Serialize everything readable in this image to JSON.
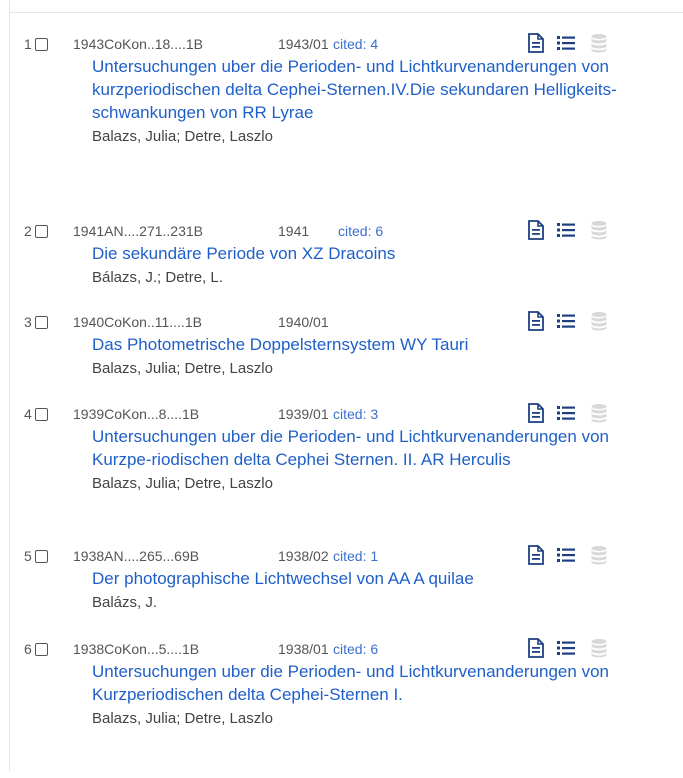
{
  "results": [
    {
      "index": "1",
      "bibcode": "1943CoKon..18....1B",
      "date": "1943/01",
      "cited": "cited: 4",
      "title": "Untersuchungen uber die Perioden- und Lichtkurvenanderungen von kurzperiodischen delta Cephei-Sternen.IV.Die sekundaren Helligkeits- schwankungen von RR Lyrae",
      "authors": "Balazs, Julia;  Detre, Laszlo"
    },
    {
      "index": "2",
      "bibcode": "1941AN....271..231B",
      "date": "1941",
      "cited": "cited: 6",
      "title": "Die sekundäre Periode von XZ Dracoins",
      "authors": "Bálazs, J.;  Detre, L."
    },
    {
      "index": "3",
      "bibcode": "1940CoKon..11....1B",
      "date": "1940/01",
      "cited": "",
      "title": "Das Photometrische Doppelsternsystem WY Tauri",
      "authors": "Balazs, Julia;  Detre, Laszlo"
    },
    {
      "index": "4",
      "bibcode": "1939CoKon...8....1B",
      "date": "1939/01",
      "cited": "cited: 3",
      "title": "Untersuchungen uber die Perioden- und Lichtkurvenanderungen von Kurzpe-riodischen delta Cephei Sternen. II. AR Herculis",
      "authors": "Balazs, Julia;  Detre, Laszlo"
    },
    {
      "index": "5",
      "bibcode": "1938AN....265...69B",
      "date": "1938/02",
      "cited": "cited: 1",
      "title": "Der photographische Lichtwechsel von AA A quilae",
      "authors": "Balázs, J."
    },
    {
      "index": "6",
      "bibcode": "1938CoKon...5....1B",
      "date": "1938/01",
      "cited": "cited: 6",
      "title": "Untersuchungen uber die Perioden- und Lichtkurvenanderungen von Kurzperiodischen delta Cephei-Sternen I.",
      "authors": "Balazs, Julia;  Detre, Laszlo"
    }
  ],
  "icons": {
    "abstract": "document-icon",
    "references": "list-icon",
    "data": "database-icon"
  },
  "colors": {
    "title_link": "#1f5fc9",
    "cited_link": "#3b6fd0",
    "icon_active": "#1e3f80",
    "icon_disabled": "#d8d8d8"
  }
}
